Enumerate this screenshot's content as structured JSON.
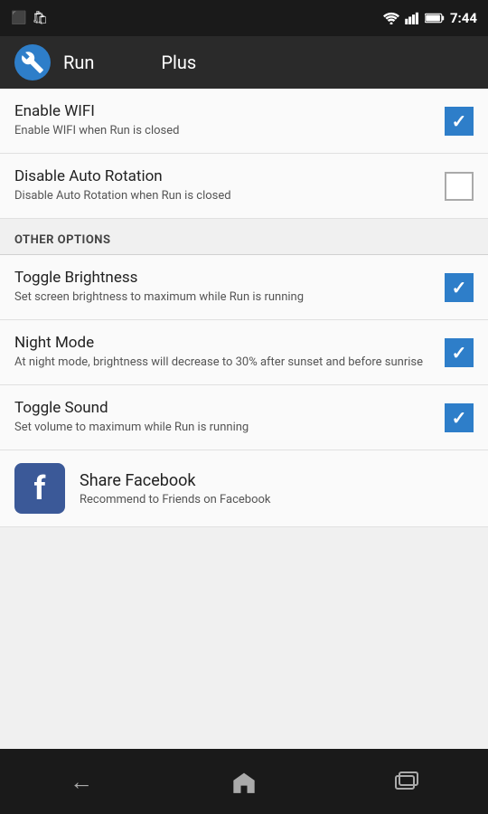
{
  "statusBar": {
    "time": "7:44",
    "icons": [
      "bbm",
      "store",
      "wifi",
      "signal",
      "battery"
    ]
  },
  "appBar": {
    "logoIcon": "wrench-icon",
    "title": "Run",
    "subtitle": "Plus"
  },
  "settings": [
    {
      "id": "enable-wifi",
      "title": "Enable WIFI",
      "description": "Enable WIFI when Run         is closed",
      "checked": true
    },
    {
      "id": "disable-auto-rotation",
      "title": "Disable Auto Rotation",
      "description": "Disable Auto Rotation when Run         is closed",
      "checked": false
    }
  ],
  "otherOptionsHeader": "OTHER OPTIONS",
  "otherOptions": [
    {
      "id": "toggle-brightness",
      "title": "Toggle Brightness",
      "description": "Set screen brightness to maximum while Run          is running",
      "checked": true
    },
    {
      "id": "night-mode",
      "title": "Night Mode",
      "description": "At night mode, brightness will decrease to 30% after sunset and before sunrise",
      "checked": true
    },
    {
      "id": "toggle-sound",
      "title": "Toggle Sound",
      "description": "Set volume to maximum while Run          is running",
      "checked": true
    }
  ],
  "facebookShare": {
    "title": "Share Facebook",
    "description": "Recommend to Friends on Facebook"
  },
  "navBar": {
    "back": "←",
    "home": "⌂",
    "recents": "▭"
  }
}
